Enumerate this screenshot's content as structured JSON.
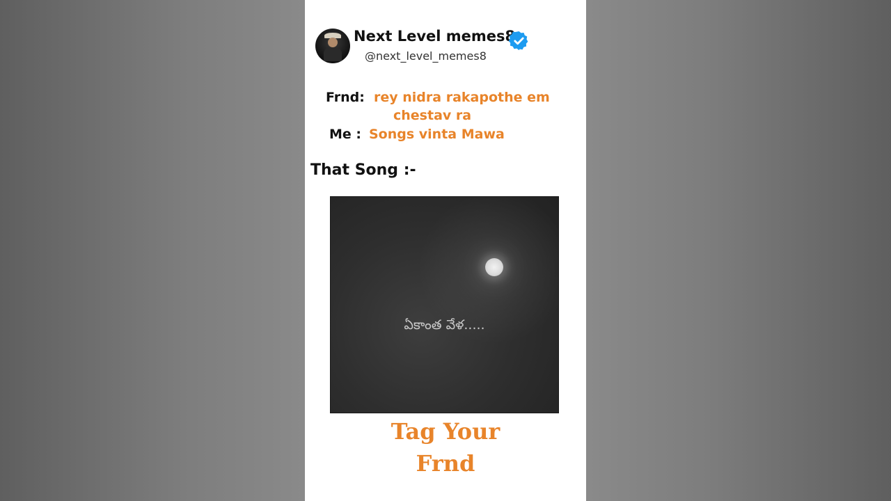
{
  "post": {
    "account_name": "Next Level memes8",
    "handle": "@next_level_memes8",
    "avatar_text": "Next level memes8",
    "verified_color": "#1d9bf0"
  },
  "dialogue": {
    "frnd_label": "Frnd:",
    "frnd_line1": "rey nidra rakapothe em",
    "frnd_line2": "chestav ra",
    "me_label": "Me :",
    "me_line": "Songs vinta Mawa"
  },
  "that_song": "That Song :-",
  "video": {
    "caption": "ఏకాంత వేళ....."
  },
  "footer": {
    "line1": "Tag Your",
    "line2": "Frnd"
  },
  "colors": {
    "accent": "#e8842a",
    "text": "#111111"
  }
}
